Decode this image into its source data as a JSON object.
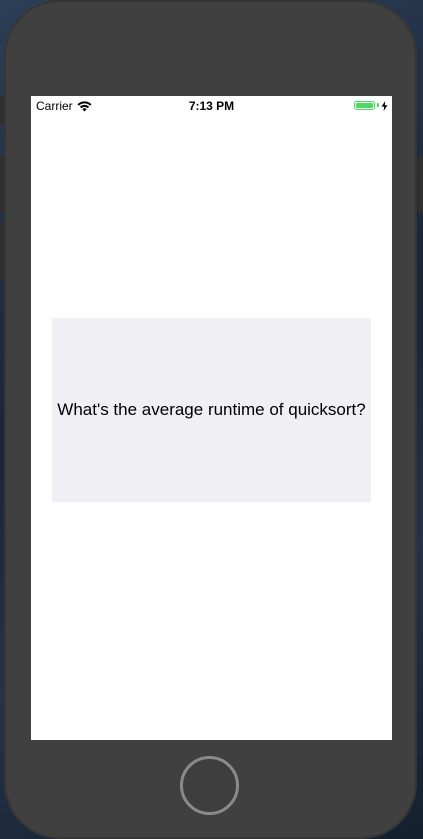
{
  "status_bar": {
    "carrier": "Carrier",
    "time": "7:13 PM",
    "wifi_icon": "wifi-icon",
    "battery_icon": "battery-icon",
    "battery_level": 1.0,
    "charging_icon": "charging-bolt-icon",
    "battery_color": "#4cd964"
  },
  "flashcard": {
    "question": "What's the average runtime of quicksort?",
    "background_color": "#efeff4"
  },
  "device": {
    "frame_color": "#404040",
    "home_button_icon": "home-button"
  }
}
